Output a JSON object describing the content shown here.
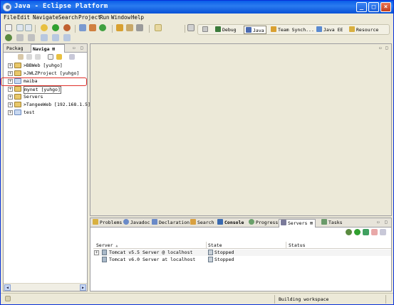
{
  "window": {
    "title": "Java - Eclipse Platform",
    "min_glyph": "_",
    "max_glyph": "□",
    "close_glyph": "×"
  },
  "menubar": {
    "items": [
      "File",
      "Edit",
      "Navigate",
      "Search",
      "Project",
      "Run",
      "Window",
      "Help"
    ]
  },
  "perspectives": {
    "items": [
      {
        "label": "Debug",
        "icon": "debug-icon",
        "color": "#3a7a3a"
      },
      {
        "label": "Java",
        "icon": "java-icon",
        "color": "#4a6ab0"
      },
      {
        "label": "Team Synch...",
        "icon": "team-synch-icon",
        "color": "#d9a030"
      },
      {
        "label": "Java EE",
        "icon": "java-ee-icon",
        "color": "#5a8ad0"
      },
      {
        "label": "Resource",
        "icon": "resource-icon",
        "color": "#d9b040"
      }
    ]
  },
  "left_view": {
    "tabs": [
      {
        "label": "Packag"
      },
      {
        "label": "Naviga ⊠"
      }
    ],
    "tree": [
      {
        "label": ">BBWeb   [yuhgo]",
        "expandable": true
      },
      {
        "label": ">JWLZProject   [yuhgo]",
        "expandable": true
      },
      {
        "label": "maiba",
        "expandable": true,
        "highlighted": true
      },
      {
        "label": "mynet   [yuhgo]",
        "expandable": true,
        "boxed": true
      },
      {
        "label": "Servers",
        "expandable": true
      },
      {
        "label": ">TangeeWeb   [192.168.1.5]",
        "expandable": true
      },
      {
        "label": "test",
        "expandable": true
      }
    ]
  },
  "bottom_view": {
    "tabs": [
      {
        "label": "Problems",
        "icon": "problems-icon",
        "color": "#d8b040"
      },
      {
        "label": "Javadoc",
        "icon": "javadoc-icon",
        "color": "#6a8ac8"
      },
      {
        "label": "Declaration",
        "icon": "declaration-icon",
        "color": "#6a8ac8"
      },
      {
        "label": "Search",
        "icon": "search-icon",
        "color": "#d8a040"
      },
      {
        "label": "Console",
        "icon": "console-icon",
        "color": "#3a6ab0",
        "bold": true
      },
      {
        "label": "Progress",
        "icon": "progress-icon",
        "color": "#6aa06a"
      },
      {
        "label": "Servers ⊠",
        "icon": "servers-icon",
        "color": "#7a7a9a",
        "active": true
      },
      {
        "label": "Tasks",
        "icon": "tasks-icon",
        "color": "#6a9a6a"
      }
    ],
    "columns": {
      "server": "Server",
      "sort_glyph": "▲",
      "state": "State",
      "status": "Status"
    },
    "rows": [
      {
        "server": "Tomcat v5.5 Server @ localhost",
        "state": "Stopped",
        "status": "",
        "expandable": true
      },
      {
        "server": "Tomcat v6.0 Server at localhost",
        "state": "Stopped",
        "status": "",
        "expandable": false
      }
    ]
  },
  "status_bar": {
    "message": "Building workspace"
  }
}
